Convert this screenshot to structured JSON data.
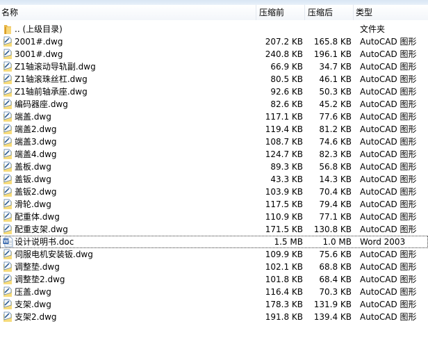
{
  "header": {
    "name": "名称",
    "before": "压缩前",
    "after": "压缩后",
    "type": "类型"
  },
  "rows": [
    {
      "icon": "folder-up-icon",
      "name": ".. (上级目录)",
      "before": "",
      "after": "",
      "type": "文件夹"
    },
    {
      "icon": "dwg-file-icon",
      "name": "2001#.dwg",
      "before": "207.2 KB",
      "after": "165.8 KB",
      "type": "AutoCAD 图形"
    },
    {
      "icon": "dwg-file-icon",
      "name": "3001#.dwg",
      "before": "240.8 KB",
      "after": "196.1 KB",
      "type": "AutoCAD 图形"
    },
    {
      "icon": "dwg-file-icon",
      "name": "Z1轴滚动导轨副.dwg",
      "before": "66.9 KB",
      "after": "34.7 KB",
      "type": "AutoCAD 图形"
    },
    {
      "icon": "dwg-file-icon",
      "name": "Z1轴滚珠丝杠.dwg",
      "before": "80.5 KB",
      "after": "46.1 KB",
      "type": "AutoCAD 图形"
    },
    {
      "icon": "dwg-file-icon",
      "name": "Z1轴前轴承座.dwg",
      "before": "92.6 KB",
      "after": "50.3 KB",
      "type": "AutoCAD 图形"
    },
    {
      "icon": "dwg-file-icon",
      "name": "编码器座.dwg",
      "before": "82.6 KB",
      "after": "45.2 KB",
      "type": "AutoCAD 图形"
    },
    {
      "icon": "dwg-file-icon",
      "name": "端盖.dwg",
      "before": "117.1 KB",
      "after": "77.6 KB",
      "type": "AutoCAD 图形"
    },
    {
      "icon": "dwg-file-icon",
      "name": "端盖2.dwg",
      "before": "119.4 KB",
      "after": "81.2 KB",
      "type": "AutoCAD 图形"
    },
    {
      "icon": "dwg-file-icon",
      "name": "端盖3.dwg",
      "before": "108.7 KB",
      "after": "74.6 KB",
      "type": "AutoCAD 图形"
    },
    {
      "icon": "dwg-file-icon",
      "name": "端盖4.dwg",
      "before": "124.7 KB",
      "after": "82.3 KB",
      "type": "AutoCAD 图形"
    },
    {
      "icon": "dwg-file-icon",
      "name": "盖板.dwg",
      "before": "89.3 KB",
      "after": "56.8 KB",
      "type": "AutoCAD 图形"
    },
    {
      "icon": "dwg-file-icon",
      "name": "盖钣.dwg",
      "before": "43.3 KB",
      "after": "14.3 KB",
      "type": "AutoCAD 图形"
    },
    {
      "icon": "dwg-file-icon",
      "name": "盖钣2.dwg",
      "before": "103.9 KB",
      "after": "70.4 KB",
      "type": "AutoCAD 图形"
    },
    {
      "icon": "dwg-file-icon",
      "name": "滑轮.dwg",
      "before": "117.5 KB",
      "after": "79.4 KB",
      "type": "AutoCAD 图形"
    },
    {
      "icon": "dwg-file-icon",
      "name": "配重体.dwg",
      "before": "110.9 KB",
      "after": "77.1 KB",
      "type": "AutoCAD 图形"
    },
    {
      "icon": "dwg-file-icon",
      "name": "配重支架.dwg",
      "before": "171.5 KB",
      "after": "130.8 KB",
      "type": "AutoCAD 图形"
    },
    {
      "icon": "word-doc-icon",
      "name": "设计说明书.doc",
      "before": "1.5 MB",
      "after": "1.0 MB",
      "type": "Word 2003",
      "focused": true
    },
    {
      "icon": "dwg-file-icon",
      "name": "伺服电机安装钣.dwg",
      "before": "109.9 KB",
      "after": "75.6 KB",
      "type": "AutoCAD 图形"
    },
    {
      "icon": "dwg-file-icon",
      "name": "调整垫.dwg",
      "before": "102.1 KB",
      "after": "68.8 KB",
      "type": "AutoCAD 图形"
    },
    {
      "icon": "dwg-file-icon",
      "name": "调整垫2.dwg",
      "before": "101.8 KB",
      "after": "68.4 KB",
      "type": "AutoCAD 图形"
    },
    {
      "icon": "dwg-file-icon",
      "name": "压盖.dwg",
      "before": "116.4 KB",
      "after": "70.3 KB",
      "type": "AutoCAD 图形"
    },
    {
      "icon": "dwg-file-icon",
      "name": "支架.dwg",
      "before": "178.3 KB",
      "after": "131.9 KB",
      "type": "AutoCAD 图形"
    },
    {
      "icon": "dwg-file-icon",
      "name": "支架2.dwg",
      "before": "191.8 KB",
      "after": "139.4 KB",
      "type": "AutoCAD 图形"
    }
  ]
}
